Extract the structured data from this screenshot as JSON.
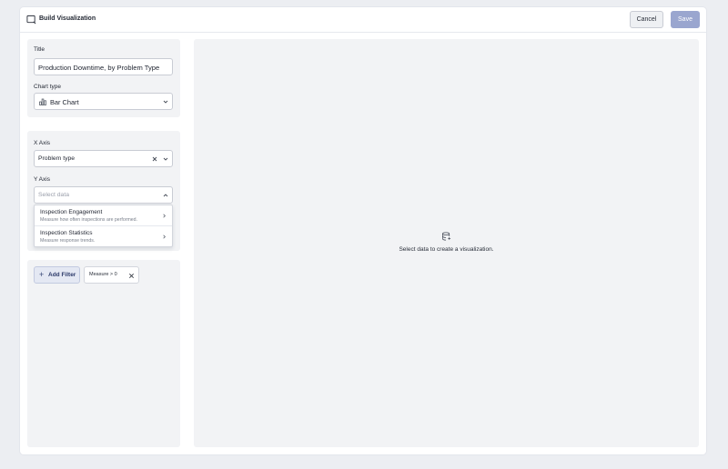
{
  "header": {
    "title": "Build Visualization",
    "cancel_label": "Cancel",
    "save_label": "Save"
  },
  "config": {
    "title_label": "Title",
    "title_value": "Production Downtime, by Problem Type",
    "chart_type_label": "Chart type",
    "chart_type_value": "Bar Chart"
  },
  "axes": {
    "x_label": "X Axis",
    "x_value": "Problem type",
    "y_label": "Y Axis",
    "y_placeholder": "Select data",
    "y_options": [
      {
        "title": "Inspection Engagement",
        "description": "Measure how often inspections are performed."
      },
      {
        "title": "Inspection Statistics",
        "description": "Measure response trends."
      }
    ]
  },
  "filters": {
    "add_label": "Add Filter",
    "chips": [
      {
        "label": "Measure > 0"
      }
    ]
  },
  "preview": {
    "empty_message": "Select data to create a visualization."
  },
  "colors": {
    "primary_disabled": "#9aa6cf",
    "panel_bg": "#f2f3f5",
    "page_bg": "#eceef2"
  }
}
